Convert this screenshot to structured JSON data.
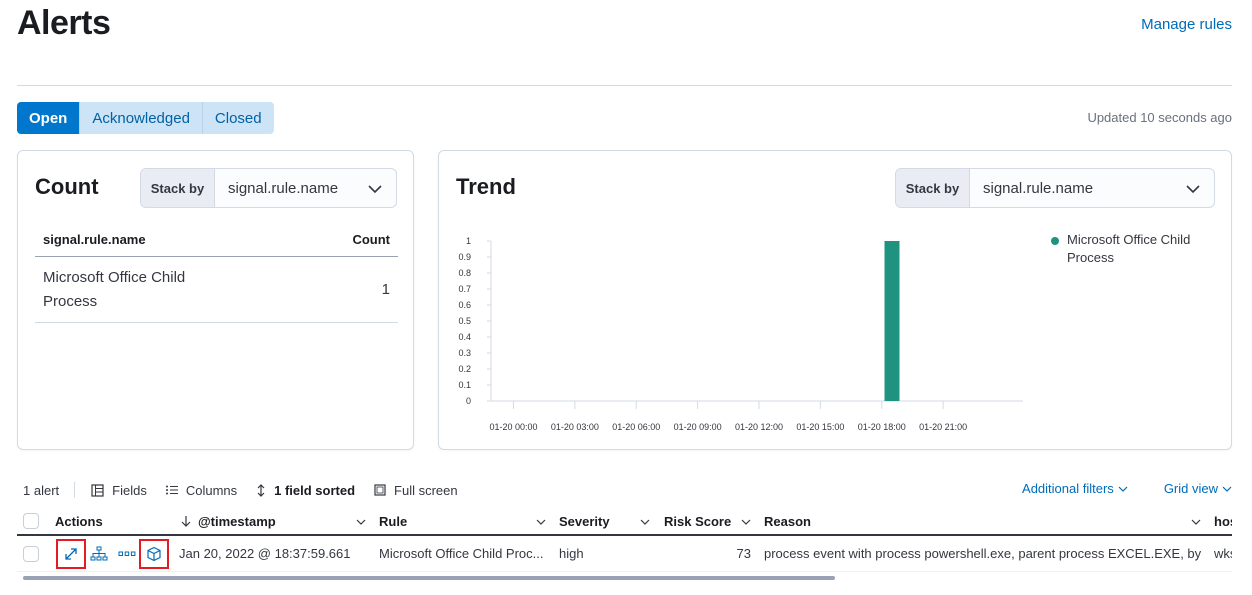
{
  "page": {
    "title": "Alerts",
    "manage_rules": "Manage rules",
    "updated": "Updated 10 seconds ago"
  },
  "status_tabs": [
    {
      "label": "Open",
      "active": true
    },
    {
      "label": "Acknowledged",
      "active": false
    },
    {
      "label": "Closed",
      "active": false
    }
  ],
  "count_panel": {
    "title": "Count",
    "stack_by_label": "Stack by",
    "stack_by_value": "signal.rule.name",
    "table": {
      "headers": [
        "signal.rule.name",
        "Count"
      ],
      "rows": [
        {
          "name": "Microsoft Office Child Process",
          "count": "1"
        }
      ]
    }
  },
  "trend_panel": {
    "title": "Trend",
    "stack_by_label": "Stack by",
    "stack_by_value": "signal.rule.name"
  },
  "chart_data": {
    "type": "bar",
    "title": "",
    "xlabel": "",
    "ylabel": "",
    "y_ticks": [
      "0",
      "0.1",
      "0.2",
      "0.3",
      "0.4",
      "0.5",
      "0.6",
      "0.7",
      "0.8",
      "0.9",
      "1"
    ],
    "ylim": [
      0,
      1
    ],
    "x_ticks": [
      "01-20 00:00",
      "01-20 03:00",
      "01-20 06:00",
      "01-20 09:00",
      "01-20 12:00",
      "01-20 15:00",
      "01-20 18:00",
      "01-20 21:00"
    ],
    "series": [
      {
        "name": "Microsoft Office Child Process",
        "color": "#209280",
        "points": [
          {
            "x": "01-20 18:30",
            "y": 1
          }
        ]
      }
    ],
    "legend_position": "right"
  },
  "toolbar": {
    "count": "1 alert",
    "fields": "Fields",
    "columns": "Columns",
    "sorted": "1 field sorted",
    "fullscreen": "Full screen",
    "additional_filters": "Additional filters",
    "grid_view": "Grid view"
  },
  "grid": {
    "columns": [
      "Actions",
      "@timestamp",
      "Rule",
      "Severity",
      "Risk Score",
      "Reason",
      "hos"
    ],
    "rows": [
      {
        "timestamp": "Jan 20, 2022 @ 18:37:59.661",
        "rule": "Microsoft Office Child Proc...",
        "severity": "high",
        "risk_score": "73",
        "reason": "process event with process powershell.exe, parent process EXCEL.EXE, by ...",
        "host": "wks"
      }
    ]
  },
  "colors": {
    "accent": "#0077cc",
    "link": "#006bb8",
    "bar": "#209280",
    "highlight_border": "#e31b23"
  },
  "icons": {
    "toolbar": [
      "fields-icon",
      "columns-icon",
      "sort-icon",
      "fullscreen-icon"
    ],
    "row_actions": [
      "expand-icon",
      "analyze-event-icon",
      "more-actions-icon",
      "session-view-icon"
    ]
  }
}
